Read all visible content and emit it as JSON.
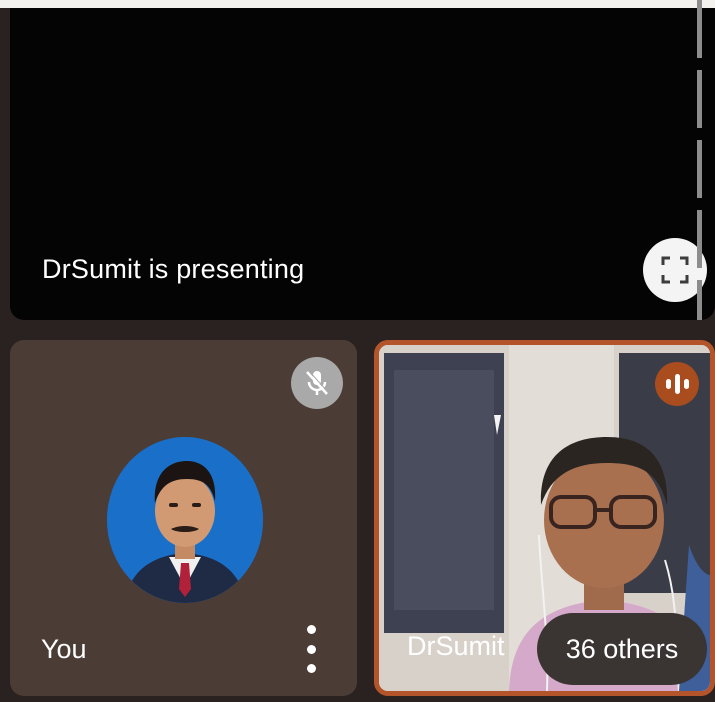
{
  "presentation": {
    "label": "DrSumit is presenting",
    "fullscreen_icon": "fullscreen-icon"
  },
  "self_tile": {
    "name": "You",
    "status_icon": "mic-off-icon",
    "menu_icon": "more-vert-icon"
  },
  "presenter_tile": {
    "name": "DrSumit",
    "status_icon": "speaking-indicator-icon",
    "highlight_color": "#b4542a"
  },
  "others_chip": {
    "label": "36 others"
  },
  "colors": {
    "presentation_bg": "#040404",
    "self_tile_bg": "#4b3d36",
    "speaking_badge": "#a94d1f"
  }
}
